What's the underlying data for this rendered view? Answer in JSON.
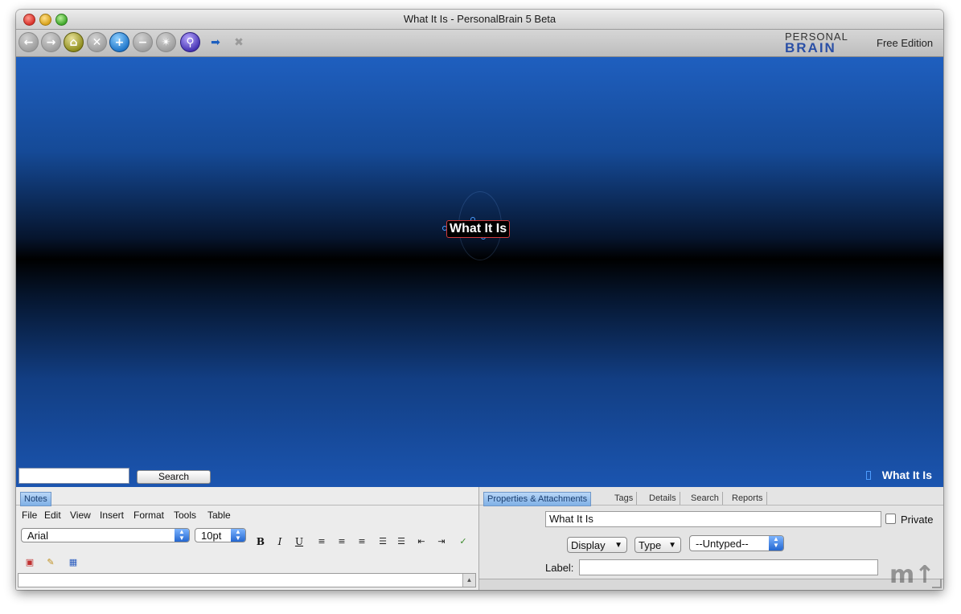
{
  "window": {
    "title": "What It Is - PersonalBrain 5 Beta"
  },
  "toolbar": {
    "buttons": [
      {
        "name": "back",
        "glyph": "←"
      },
      {
        "name": "forward",
        "glyph": "→"
      },
      {
        "name": "home",
        "glyph": "⌂"
      },
      {
        "name": "unlink",
        "glyph": "✕"
      },
      {
        "name": "add",
        "glyph": "+"
      },
      {
        "name": "remove",
        "glyph": "−"
      },
      {
        "name": "network",
        "glyph": "✴"
      },
      {
        "name": "search",
        "glyph": "⚲"
      }
    ],
    "extra_icons": [
      {
        "name": "link-add",
        "glyph": "➡"
      },
      {
        "name": "link-remove",
        "glyph": "✖"
      }
    ],
    "logo_line1": "PERSONAL",
    "logo_line2": "BRAIN",
    "edition": "Free Edition"
  },
  "plex": {
    "active_thought": "What It Is",
    "search_button": "Search",
    "search_value": "",
    "active_thought_footer": "What It Is"
  },
  "notes": {
    "tab": "Notes",
    "menu": [
      "File",
      "Edit",
      "View",
      "Insert",
      "Format",
      "Tools",
      "Table"
    ],
    "font": "Arial",
    "size": "10pt",
    "format_buttons": [
      "B",
      "I",
      "U"
    ],
    "align_icons": [
      "≡",
      "≡",
      "≡"
    ],
    "list_icons": [
      "☰",
      "☰",
      "⇤",
      "⇥"
    ]
  },
  "properties": {
    "tabs": [
      "Properties & Attachments",
      "Tags",
      "Details",
      "Search",
      "Reports"
    ],
    "name_value": "What It Is",
    "private_label": "Private",
    "display_label": "Display",
    "type_label": "Type",
    "untyped_label": "--Untyped--",
    "label_label": "Label:",
    "label_value": ""
  },
  "colors": {
    "plex_top": "#1f5fbf",
    "plex_middle": "#000000",
    "accent_blue": "#2467d0",
    "thought_border": "#d23a3a"
  }
}
